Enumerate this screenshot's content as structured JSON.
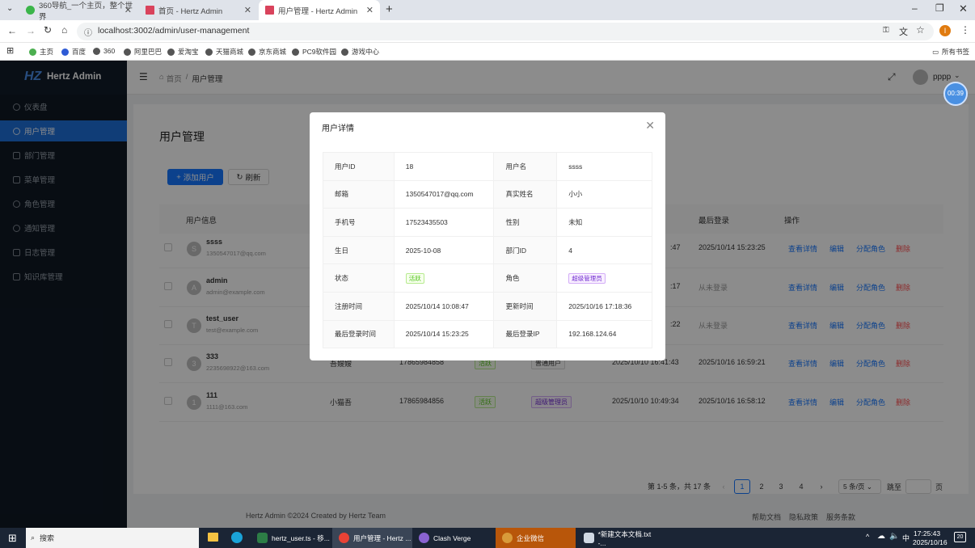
{
  "browser": {
    "tabs": [
      {
        "title": "360导航_一个主页，整个世界",
        "icon": "360-icon",
        "active": false
      },
      {
        "title": "首页 - Hertz Admin",
        "icon": "vue-icon",
        "active": false
      },
      {
        "title": "用户管理 - Hertz Admin",
        "icon": "vue-icon",
        "active": true
      }
    ],
    "url": "localhost:3002/admin/user-management",
    "profile_initial": "I",
    "bookmarks": [
      "主页",
      "百度",
      "360",
      "阿里巴巴",
      "爱淘宝",
      "天猫商城",
      "京东商城",
      "PC9软件园",
      "游戏中心"
    ],
    "all_bookmarks": "所有书签"
  },
  "app": {
    "name": "Hertz Admin",
    "logo_text": "HZ",
    "menu": [
      "仪表盘",
      "用户管理",
      "部门管理",
      "菜单管理",
      "角色管理",
      "通知管理",
      "日志管理",
      "知识库管理"
    ],
    "selected_menu": 1,
    "breadcrumb": [
      "首页",
      "用户管理"
    ],
    "username": "pppp",
    "timer": "00:39",
    "page_title": "用户管理",
    "add_button": "添加用户",
    "refresh_button": "刷新",
    "columns": {
      "user_info": "用户信息",
      "last_login": "最后登录",
      "actions": "操作"
    },
    "rows": [
      {
        "initial": "S",
        "name": "ssss",
        "email": "1350547017@qq.com",
        "real_name": "",
        "phone": "",
        "status": "",
        "role": "",
        "created": ":47",
        "last_login": "2025/10/14 15:23:25"
      },
      {
        "initial": "A",
        "name": "admin",
        "email": "admin@example.com",
        "real_name": "",
        "phone": "",
        "status": "",
        "role": "",
        "created": ":17",
        "last_login": "从未登录"
      },
      {
        "initial": "T",
        "name": "test_user",
        "email": "test@example.com",
        "real_name": "",
        "phone": "",
        "status": "",
        "role": "",
        "created": ":22",
        "last_login": "从未登录"
      },
      {
        "initial": "3",
        "name": "333",
        "email": "2235698922@163.com",
        "real_name": "吾嫂嫂",
        "phone": "17865984858",
        "status": "活跃",
        "role": "普通用户",
        "created": "2025/10/10 16:41:43",
        "last_login": "2025/10/16 16:59:21"
      },
      {
        "initial": "1",
        "name": "111",
        "email": "1111@163.com",
        "real_name": "小猫吾",
        "phone": "17865984856",
        "status": "活跃",
        "role": "超级管理员",
        "created": "2025/10/10 10:49:34",
        "last_login": "2025/10/16 16:58:12"
      }
    ],
    "actions": {
      "view": "查看详情",
      "edit": "编辑",
      "assign": "分配角色",
      "delete": "删除"
    },
    "pagination": {
      "summary": "第 1-5 条，共 17 条",
      "pages": [
        "1",
        "2",
        "3",
        "4"
      ],
      "current": "1",
      "page_size": "5 条/页",
      "jump_label": "跳至",
      "jump_unit": "页"
    },
    "footer": {
      "copyright": "Hertz Admin ©2024 Created by Hertz Team",
      "links": [
        "帮助文档",
        "隐私政策",
        "服务条款"
      ]
    }
  },
  "modal": {
    "title": "用户详情",
    "fields": [
      {
        "label1": "用户ID",
        "value1": "18",
        "label2": "用户名",
        "value2": "ssss"
      },
      {
        "label1": "邮箱",
        "value1": "1350547017@qq.com",
        "label2": "真实姓名",
        "value2": "小小"
      },
      {
        "label1": "手机号",
        "value1": "17523435503",
        "label2": "性别",
        "value2": "未知"
      },
      {
        "label1": "生日",
        "value1": "2025-10-08",
        "label2": "部门ID",
        "value2": "4"
      },
      {
        "label1": "状态",
        "value1": "活跃",
        "label2": "角色",
        "value2": "超级管理员"
      },
      {
        "label1": "注册时间",
        "value1": "2025/10/14 10:08:47",
        "label2": "更新时间",
        "value2": "2025/10/16 17:18:36"
      },
      {
        "label1": "最后登录时间",
        "value1": "2025/10/14 15:23:25",
        "label2": "最后登录IP",
        "value2": "192.168.124.64"
      }
    ]
  },
  "taskbar": {
    "search": "搜索",
    "items": [
      "hertz_user.ts - 移...",
      "用户管理 - Hertz ...",
      "Clash Verge",
      "企业微信",
      "*新建文本文档.txt -..."
    ],
    "ime": "中",
    "time": "17:25:43",
    "date": "2025/10/16",
    "notify_count": "20"
  },
  "colors": {
    "primary": "#1677ff",
    "sidebar": "#0f1824",
    "danger": "#ff4d4f",
    "success": "#52c41a",
    "purple": "#722ed1"
  }
}
